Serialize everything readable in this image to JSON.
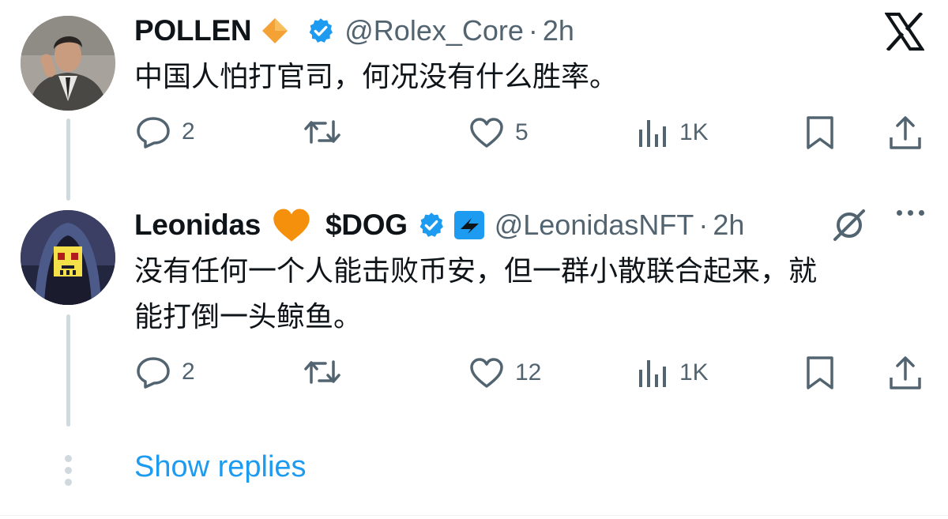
{
  "branding": {
    "logo_icon": "x-logo-icon"
  },
  "colors": {
    "accent": "#1d9bf0",
    "muted": "#536471",
    "text": "#0f1419",
    "verified": "#1d9bf0",
    "diamond": "#f4a236",
    "heart_emoji": "#f4900c"
  },
  "tweets": [
    {
      "display_name": "POLLEN",
      "emoji_badge": "orange-diamond-icon",
      "verified": true,
      "handle": "@Rolex_Core",
      "separator": "·",
      "time": "2h",
      "text": "中国人怕打官司，何况没有什么胜率。",
      "actions": {
        "replies": "2",
        "reposts": "",
        "likes": "5",
        "views": "1K"
      }
    },
    {
      "display_name": "Leonidas",
      "emoji_badge": "orange-heart-icon",
      "ticker": "$DOG",
      "verified": true,
      "affiliate_icon": "affiliate-bolt-icon",
      "handle": "@LeonidasNFT",
      "separator": "·",
      "time": "2h",
      "text_line1": "没有任何一个人能击败币安，但一群小散联合起来，就",
      "text_line2": "能打倒一头鲸鱼。",
      "actions": {
        "replies": "2",
        "reposts": "",
        "likes": "12",
        "views": "1K"
      }
    }
  ],
  "show_replies": "Show replies"
}
